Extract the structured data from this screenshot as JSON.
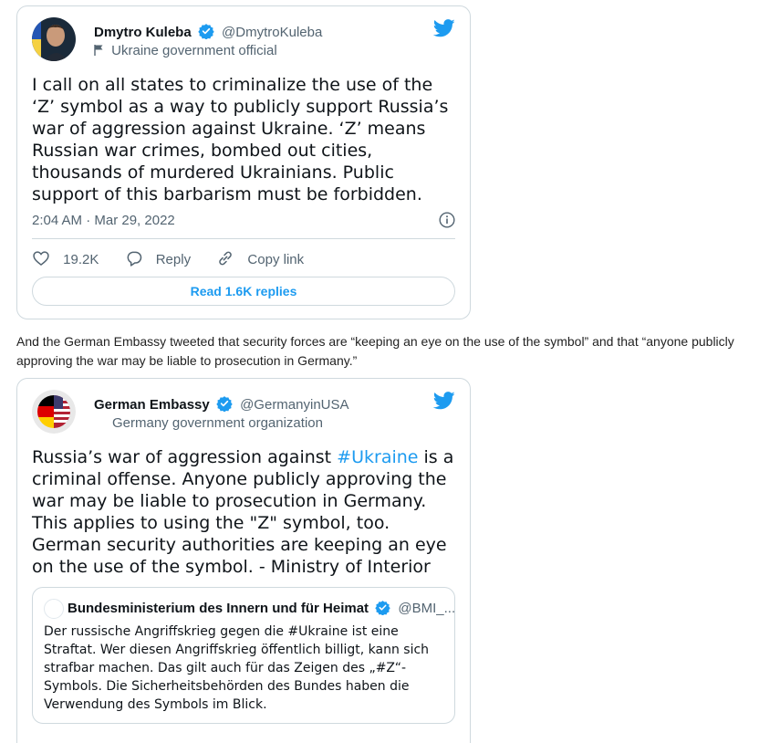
{
  "tweet1": {
    "author_name": "Dmytro Kuleba",
    "author_handle": "@DmytroKuleba",
    "account_label": "Ukraine government official",
    "text": "I call on all states to criminalize the use of the ‘Z’ symbol as a way to publicly support Russia’s war of aggression against Ukraine. ‘Z’ means Russian war crimes, bombed out cities, thousands of murdered Ukrainians. Public support of this barbarism must be forbidden.",
    "timestamp": "2:04 AM · Mar 29, 2022",
    "like_count": "19.2K",
    "reply_label": "Reply",
    "copy_link_label": "Copy link",
    "read_replies_label": "Read 1.6K replies"
  },
  "between_text": "And the German Embassy tweeted that security forces are “keeping an eye on the use of the symbol” and that “anyone publicly approving the war may be liable to prosecution in Germany.”",
  "tweet2": {
    "author_name": "German Embassy",
    "author_handle": "@GermanyinUSA",
    "account_label": "Germany government organization",
    "text_before_hashtag": "Russia’s war of aggression against ",
    "hashtag": "#Ukraine",
    "text_after_hashtag": " is a criminal offense. Anyone publicly approving the war may be liable to prosecution in Germany. This applies to using the \"Z\" symbol, too. German security authorities are keeping an eye on the use of the symbol. - Ministry of Interior",
    "quoted": {
      "author_name": "Bundesministerium des Innern und für Heimat",
      "author_handle": "@BMI_...",
      "text": "Der russische Angriffskrieg gegen die #Ukraine ist eine Straftat. Wer diesen Angriffskrieg öffentlich billigt, kann sich strafbar machen. Das gilt auch für das Zeigen des „#Z“-Symbols. Die Sicherheitsbehörden des Bundes haben die Verwendung des Symbols im Blick."
    }
  },
  "colors": {
    "twitter_blue": "#1d9bf0",
    "secondary_text": "#536471",
    "border": "#cfd9de"
  },
  "icons": [
    "verified-badge-icon",
    "twitter-bird-icon",
    "flag-icon",
    "info-icon",
    "heart-icon",
    "reply-icon",
    "copy-link-icon"
  ]
}
